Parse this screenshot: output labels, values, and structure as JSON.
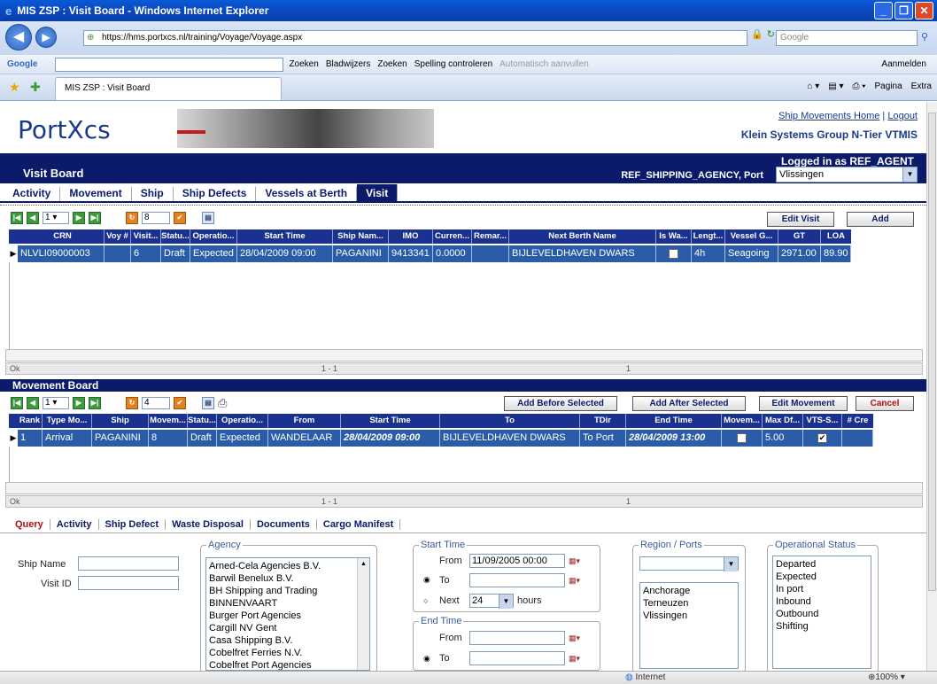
{
  "window": {
    "title": "MIS ZSP : Visit Board - Windows Internet Explorer"
  },
  "browser": {
    "url": "https://hms.portxcs.nl/training/Voyage/Voyage.aspx",
    "search_placeholder": "Google",
    "google_label": "Google",
    "toolbar_items": [
      "Zoeken",
      "Bladwijzers",
      "Zoeken",
      "Spelling controleren",
      "Automatisch aanvullen",
      "Aanmelden"
    ],
    "tab_title": "MIS ZSP : Visit Board",
    "tools": [
      "Pagina",
      "Extra"
    ]
  },
  "header": {
    "logo": "PortXcs",
    "home_link": "Ship Movements Home",
    "logout_link": "Logout",
    "company": "Klein Systems Group N-Tier VTMIS",
    "logged_in": "Logged in as REF_AGENT",
    "agency_port": "REF_SHIPPING_AGENCY, Port",
    "port_value": "Vlissingen",
    "board_title": "Visit Board"
  },
  "tabs": [
    "Activity",
    "Movement",
    "Ship",
    "Ship Defects",
    "Vessels at Berth",
    "Visit"
  ],
  "visit_grid": {
    "page": "1",
    "page_size": "8",
    "edit_btn": "Edit Visit",
    "add_btn": "Add",
    "columns": [
      "CRN",
      "Voy #",
      "Visit...",
      "Statu...",
      "Operatio...",
      "Start Time",
      "Ship Nam...",
      "IMO",
      "Curren...",
      "Remar...",
      "Next Berth Name",
      "Is Wa...",
      "Lengt...",
      "Vessel G...",
      "GT",
      "LOA"
    ],
    "row": [
      "NLVLI09000003",
      "",
      "6",
      "Draft",
      "Expected",
      "28/04/2009 09:00",
      "PAGANINI",
      "9413341",
      "0.0000",
      "",
      "BIJLEVELDHAVEN DWARS",
      "",
      "4h",
      "Seagoing",
      "2971.00",
      "89.90"
    ],
    "status_left": "Ok",
    "status_mid": "1 - 1",
    "status_right": "1"
  },
  "movement_board": {
    "title": "Movement Board",
    "page": "1",
    "page_size": "4",
    "buttons": [
      "Add Before Selected",
      "Add After Selected",
      "Edit Movement",
      "Cancel"
    ],
    "columns": [
      "Rank",
      "Type Mo...",
      "Ship",
      "Movem...",
      "Statu...",
      "Operatio...",
      "From",
      "Start Time",
      "To",
      "TDir",
      "End Time",
      "Movem...",
      "Max Df...",
      "VTS-S...",
      "# Cre"
    ],
    "row": [
      "1",
      "Arrival",
      "PAGANINI",
      "8",
      "Draft",
      "Expected",
      "WANDELAAR",
      "28/04/2009 09:00",
      "BIJLEVELDHAVEN DWARS",
      "To Port",
      "28/04/2009 13:00",
      "",
      "5.00",
      "✔",
      ""
    ],
    "status_left": "Ok",
    "status_mid": "1 - 1",
    "status_right": "1"
  },
  "query_tabs": [
    "Query",
    "Activity",
    "Ship Defect",
    "Waste Disposal",
    "Documents",
    "Cargo Manifest"
  ],
  "query": {
    "ship_name_label": "Ship Name",
    "visit_id_label": "Visit ID",
    "agency_legend": "Agency",
    "agencies": [
      "Arned-Cela Agencies B.V.",
      "Barwil Benelux B.V.",
      "BH Shipping and Trading",
      "BINNENVAART",
      "Burger Port Agencies",
      "Cargill NV Gent",
      "Casa Shipping B.V.",
      "Cobelfret Ferries N.V.",
      "Cobelfret Port Agencies"
    ],
    "start_time_legend": "Start Time",
    "from_label": "From",
    "from_value": "11/09/2005 00:00",
    "to_label": "To",
    "next_label": "Next",
    "next_value": "24",
    "hours_label": "hours",
    "end_time_legend": "End Time",
    "end_from_label": "From",
    "end_to_label": "To",
    "region_legend": "Region / Ports",
    "ports": [
      "Anchorage",
      "Terneuzen",
      "Vlissingen"
    ],
    "opstatus_legend": "Operational Status",
    "statuses": [
      "Departed",
      "Expected",
      "In port",
      "Inbound",
      "Outbound",
      "Shifting"
    ]
  },
  "ie_status": {
    "zone": "Internet",
    "zoom": "100%"
  }
}
